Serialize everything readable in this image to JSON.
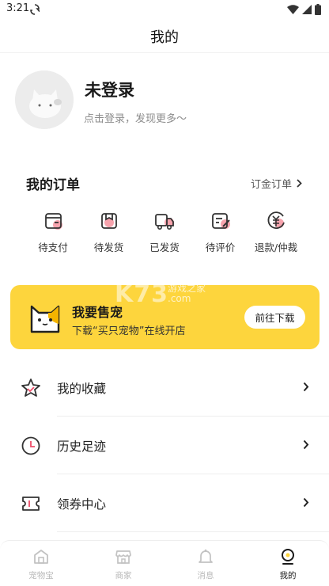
{
  "status_bar": {
    "time": "3:21"
  },
  "header": {
    "title": "我的"
  },
  "profile": {
    "name": "未登录",
    "subtitle": "点击登录，发现更多～"
  },
  "orders": {
    "title": "我的订单",
    "all_label": "订金订单",
    "items": [
      {
        "label": "待支付",
        "icon": "wallet-icon"
      },
      {
        "label": "待发货",
        "icon": "package-icon"
      },
      {
        "label": "已发货",
        "icon": "truck-icon"
      },
      {
        "label": "待评价",
        "icon": "review-icon"
      },
      {
        "label": "退款/仲裁",
        "icon": "refund-icon"
      }
    ]
  },
  "banner": {
    "title": "我要售宠",
    "subtitle": "下载“买只宠物”在线开店",
    "button": "前往下载",
    "color": "#fdd53d"
  },
  "watermark": {
    "brand": "K73",
    "line1": "游戏之家",
    "line2": ".com"
  },
  "menu": [
    {
      "label": "我的收藏",
      "icon": "star-icon"
    },
    {
      "label": "历史足迹",
      "icon": "clock-icon"
    },
    {
      "label": "领券中心",
      "icon": "coupon-icon"
    }
  ],
  "tab_bar": {
    "tabs": [
      {
        "label": "宠物宝",
        "icon": "home-icon",
        "active": false
      },
      {
        "label": "商家",
        "icon": "store-icon",
        "active": false
      },
      {
        "label": "消息",
        "icon": "bell-icon",
        "active": false
      },
      {
        "label": "我的",
        "icon": "profile-icon",
        "active": true
      }
    ]
  },
  "colors": {
    "accent": "#fdd53d",
    "highlight": "#f7a3ad",
    "text": "#1a1a1a"
  }
}
